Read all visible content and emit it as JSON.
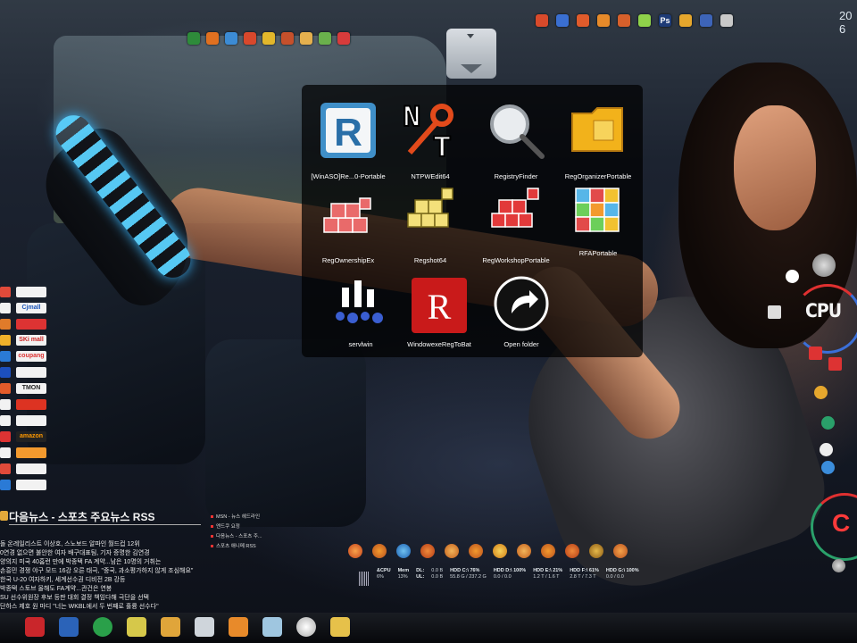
{
  "clock": {
    "year_fragment": "20",
    "day_fragment": "6"
  },
  "folder_popup": {
    "apps": [
      {
        "label": "[WinASO]Re...0-Portable",
        "icon": "regedit-r-icon"
      },
      {
        "label": "NTPWEdit64",
        "icon": "nt-key-icon"
      },
      {
        "label": "RegistryFinder",
        "icon": "magnifier-icon"
      },
      {
        "label": "RegOrganizerPortable",
        "icon": "folder-cube-icon"
      },
      {
        "label": "RegOwnershipEx",
        "icon": "registry-cubes-red-icon"
      },
      {
        "label": "Regshot64",
        "icon": "registry-cubes-yellow-icon"
      },
      {
        "label": "RegWorkshopPortable",
        "icon": "registry-cubes-red-icon"
      },
      {
        "label": "RFAPortable",
        "icon": "cube-blocks-icon"
      },
      {
        "label": "servlwin",
        "icon": "servlwin-icon"
      },
      {
        "label": "WindowexeRegToBat",
        "icon": "red-r-icon"
      },
      {
        "label": "Open folder",
        "icon": "open-folder-arrow-icon"
      }
    ]
  },
  "sites": [
    {
      "badge": ""
    },
    {
      "badge": "Cjmall"
    },
    {
      "badge": ""
    },
    {
      "badge": "SKi mall"
    },
    {
      "badge": "coupang"
    },
    {
      "badge": ""
    },
    {
      "badge": "TMON"
    },
    {
      "badge": ""
    },
    {
      "badge": ""
    },
    {
      "badge": "amazon"
    },
    {
      "badge": ""
    },
    {
      "badge": ""
    },
    {
      "badge": ""
    }
  ],
  "rss": {
    "title": "다음뉴스 - 스포츠 주요뉴스 RSS",
    "lines": [
      "돌 온레일리스트 이상호, 스노보드 알파인 월드컵 12위",
      "0연경 없으면 불안한 여자 배구대표팀, 기자 증명한 김연경",
      "양의지 미국 40홈런 만에 박종택 FA 계약...남은 10명의 거취는",
      "손흥민 경쟁 야구 모드 16강 오른 태극, \"중국, 과소평가하지 않게 조심해요\"",
      "한국 U-20 여자하키, 세계선수권 디비전 2B 강등",
      "박종택 스토브 올해도 FA계약...관건은 연봉",
      "SU 선수위원장 후보 등판 대회 결정 책임다해 극단을 선택",
      "단하스 제호 원 마디 \"너는 WKBL에서 두 번째로 훌륭 선수다\""
    ],
    "menu": [
      "MSN - 뉴스 헤드라인",
      "엔드쿠 요정",
      "다음뉴스 - 스포츠 주...",
      "스포츠 애니메 RSS"
    ]
  },
  "meters": [
    {
      "name": "&CPU",
      "value": "6%"
    },
    {
      "name": "Mem",
      "value": "13%"
    },
    {
      "name": "DL:",
      "value": "0.0 B"
    },
    {
      "name": "UL:",
      "value": "0.0 B"
    },
    {
      "name": "HDD C:\\ 76%",
      "value": "55.8 G / 237.2 G"
    },
    {
      "name": "HDD D:\\ 100%",
      "value": "0.0 / 0.0"
    },
    {
      "name": "HDD E:\\ 21%",
      "value": "1.2 T / 1.6 T"
    },
    {
      "name": "HDD F:\\ 61%",
      "value": "2.8 T / 7.3 T"
    },
    {
      "name": "HDD G:\\ 100%",
      "value": "0.0 / 0.0"
    }
  ],
  "gauges": {
    "cpu_label": "CPU",
    "drive_label": "C"
  },
  "colors": {
    "accent_red": "#ff3a3a",
    "popup_bg": "rgba(0,0,0,0.72)"
  }
}
